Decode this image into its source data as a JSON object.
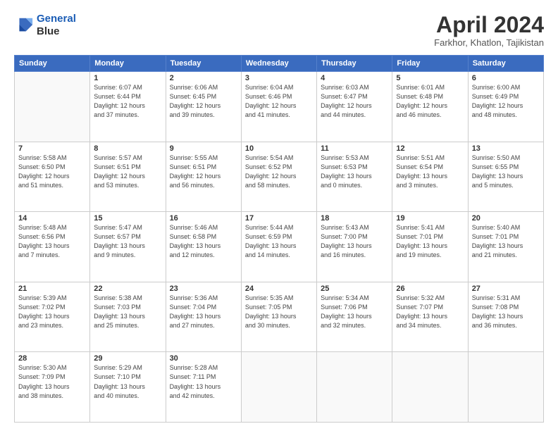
{
  "header": {
    "logo_line1": "General",
    "logo_line2": "Blue",
    "title": "April 2024",
    "subtitle": "Farkhor, Khatlon, Tajikistan"
  },
  "weekdays": [
    "Sunday",
    "Monday",
    "Tuesday",
    "Wednesday",
    "Thursday",
    "Friday",
    "Saturday"
  ],
  "weeks": [
    [
      {
        "day": "",
        "info": ""
      },
      {
        "day": "1",
        "info": "Sunrise: 6:07 AM\nSunset: 6:44 PM\nDaylight: 12 hours\nand 37 minutes."
      },
      {
        "day": "2",
        "info": "Sunrise: 6:06 AM\nSunset: 6:45 PM\nDaylight: 12 hours\nand 39 minutes."
      },
      {
        "day": "3",
        "info": "Sunrise: 6:04 AM\nSunset: 6:46 PM\nDaylight: 12 hours\nand 41 minutes."
      },
      {
        "day": "4",
        "info": "Sunrise: 6:03 AM\nSunset: 6:47 PM\nDaylight: 12 hours\nand 44 minutes."
      },
      {
        "day": "5",
        "info": "Sunrise: 6:01 AM\nSunset: 6:48 PM\nDaylight: 12 hours\nand 46 minutes."
      },
      {
        "day": "6",
        "info": "Sunrise: 6:00 AM\nSunset: 6:49 PM\nDaylight: 12 hours\nand 48 minutes."
      }
    ],
    [
      {
        "day": "7",
        "info": "Sunrise: 5:58 AM\nSunset: 6:50 PM\nDaylight: 12 hours\nand 51 minutes."
      },
      {
        "day": "8",
        "info": "Sunrise: 5:57 AM\nSunset: 6:51 PM\nDaylight: 12 hours\nand 53 minutes."
      },
      {
        "day": "9",
        "info": "Sunrise: 5:55 AM\nSunset: 6:51 PM\nDaylight: 12 hours\nand 56 minutes."
      },
      {
        "day": "10",
        "info": "Sunrise: 5:54 AM\nSunset: 6:52 PM\nDaylight: 12 hours\nand 58 minutes."
      },
      {
        "day": "11",
        "info": "Sunrise: 5:53 AM\nSunset: 6:53 PM\nDaylight: 13 hours\nand 0 minutes."
      },
      {
        "day": "12",
        "info": "Sunrise: 5:51 AM\nSunset: 6:54 PM\nDaylight: 13 hours\nand 3 minutes."
      },
      {
        "day": "13",
        "info": "Sunrise: 5:50 AM\nSunset: 6:55 PM\nDaylight: 13 hours\nand 5 minutes."
      }
    ],
    [
      {
        "day": "14",
        "info": "Sunrise: 5:48 AM\nSunset: 6:56 PM\nDaylight: 13 hours\nand 7 minutes."
      },
      {
        "day": "15",
        "info": "Sunrise: 5:47 AM\nSunset: 6:57 PM\nDaylight: 13 hours\nand 9 minutes."
      },
      {
        "day": "16",
        "info": "Sunrise: 5:46 AM\nSunset: 6:58 PM\nDaylight: 13 hours\nand 12 minutes."
      },
      {
        "day": "17",
        "info": "Sunrise: 5:44 AM\nSunset: 6:59 PM\nDaylight: 13 hours\nand 14 minutes."
      },
      {
        "day": "18",
        "info": "Sunrise: 5:43 AM\nSunset: 7:00 PM\nDaylight: 13 hours\nand 16 minutes."
      },
      {
        "day": "19",
        "info": "Sunrise: 5:41 AM\nSunset: 7:01 PM\nDaylight: 13 hours\nand 19 minutes."
      },
      {
        "day": "20",
        "info": "Sunrise: 5:40 AM\nSunset: 7:01 PM\nDaylight: 13 hours\nand 21 minutes."
      }
    ],
    [
      {
        "day": "21",
        "info": "Sunrise: 5:39 AM\nSunset: 7:02 PM\nDaylight: 13 hours\nand 23 minutes."
      },
      {
        "day": "22",
        "info": "Sunrise: 5:38 AM\nSunset: 7:03 PM\nDaylight: 13 hours\nand 25 minutes."
      },
      {
        "day": "23",
        "info": "Sunrise: 5:36 AM\nSunset: 7:04 PM\nDaylight: 13 hours\nand 27 minutes."
      },
      {
        "day": "24",
        "info": "Sunrise: 5:35 AM\nSunset: 7:05 PM\nDaylight: 13 hours\nand 30 minutes."
      },
      {
        "day": "25",
        "info": "Sunrise: 5:34 AM\nSunset: 7:06 PM\nDaylight: 13 hours\nand 32 minutes."
      },
      {
        "day": "26",
        "info": "Sunrise: 5:32 AM\nSunset: 7:07 PM\nDaylight: 13 hours\nand 34 minutes."
      },
      {
        "day": "27",
        "info": "Sunrise: 5:31 AM\nSunset: 7:08 PM\nDaylight: 13 hours\nand 36 minutes."
      }
    ],
    [
      {
        "day": "28",
        "info": "Sunrise: 5:30 AM\nSunset: 7:09 PM\nDaylight: 13 hours\nand 38 minutes."
      },
      {
        "day": "29",
        "info": "Sunrise: 5:29 AM\nSunset: 7:10 PM\nDaylight: 13 hours\nand 40 minutes."
      },
      {
        "day": "30",
        "info": "Sunrise: 5:28 AM\nSunset: 7:11 PM\nDaylight: 13 hours\nand 42 minutes."
      },
      {
        "day": "",
        "info": ""
      },
      {
        "day": "",
        "info": ""
      },
      {
        "day": "",
        "info": ""
      },
      {
        "day": "",
        "info": ""
      }
    ]
  ]
}
